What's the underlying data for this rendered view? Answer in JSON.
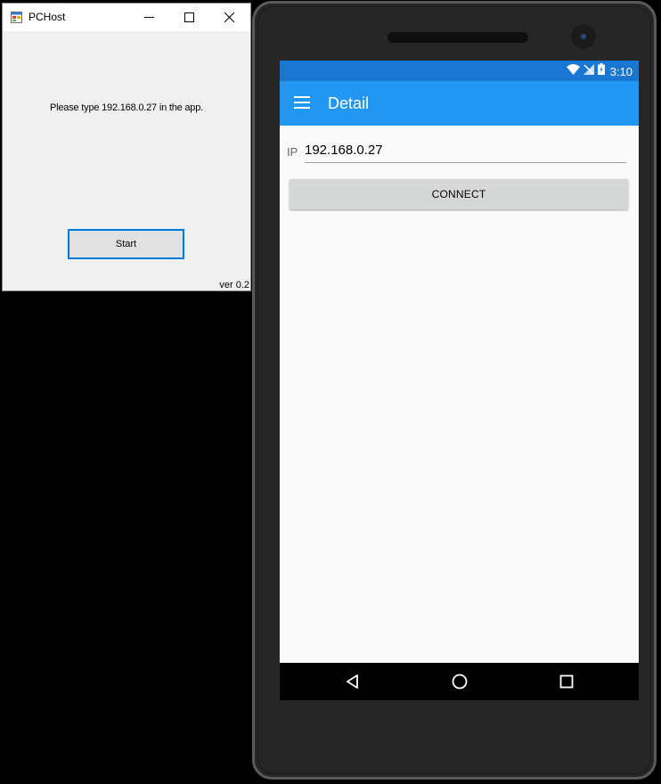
{
  "window": {
    "title": "PCHost",
    "message": "Please type 192.168.0.27 in the app.",
    "start_label": "Start",
    "version": "ver 0.2"
  },
  "phone": {
    "status": {
      "time": "3:10",
      "icons": [
        "wifi-icon",
        "no-sim-icon",
        "battery-charging-icon"
      ]
    },
    "appbar": {
      "title": "Detail",
      "menu_icon": "hamburger-menu-icon"
    },
    "form": {
      "ip_label": "IP",
      "ip_value": "192.168.0.27",
      "connect_label": "CONNECT"
    },
    "navbar": {
      "icons": [
        "back-icon",
        "home-icon",
        "recents-icon"
      ]
    }
  },
  "colors": {
    "statusbar": "#1976d2",
    "appbar": "#2196f3",
    "window_focus": "#0078d7"
  }
}
